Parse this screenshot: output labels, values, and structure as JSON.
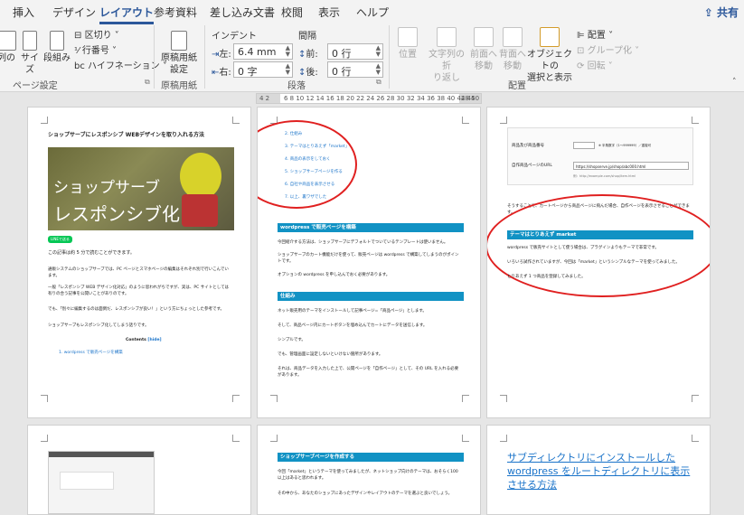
{
  "ribbon": {
    "tabs": [
      "挿入",
      "デザイン",
      "レイアウト",
      "参考資料",
      "差し込み文書",
      "校閲",
      "表示",
      "ヘルプ"
    ],
    "active_tab": "レイアウト",
    "share": "共有",
    "page_setup": {
      "col_label": "列の",
      "size_label": "サイズ",
      "columns_label": "段組み",
      "breaks_label": "区切り",
      "line_numbers_label": "行番号",
      "hyphenation_label": "ハイフネーション",
      "group_label": "ページ設定"
    },
    "manuscript": {
      "button_label": "原稿用紙\n設定",
      "group_label": "原稿用紙"
    },
    "paragraph": {
      "indent_header": "インデント",
      "spacing_header": "間隔",
      "left_label": "左:",
      "left_value": "6.4 mm",
      "right_label": "右:",
      "right_value": "0 字",
      "before_label": "前:",
      "before_value": "0 行",
      "after_label": "後:",
      "after_value": "0 行",
      "group_label": "段落"
    },
    "arrange": {
      "position_label": "位置",
      "wrap_label": "文字列の折\nり返し",
      "forward_label": "前面へ\n移動",
      "backward_label": "背面へ\n移動",
      "selection_label": "オブジェクトの\n選択と表示",
      "align_label": "配置",
      "group_label": "グループ化",
      "rotate_label": "回転",
      "group_name": "配置"
    }
  },
  "ruler": {
    "left_text": "4 2",
    "marks": "6 8 10 12 14 16 18 20 22 24 26 28 30 32 34 36 38 40 42 44",
    "end": "48 50"
  },
  "pages": {
    "p1": {
      "title": "ショップサーブにレスポンシブ WEBデザインを取り入れる方法",
      "image_line1": "ショップサーブ",
      "image_line2": "レスポンシブ化",
      "line_badge": "LINEで送る",
      "lines": [
        "この記事は約 5 分で読むことができます。",
        "通販システムのショップサーブでは、PC ページとスマホページの編集はそれぞれ別で行いこんでいます。",
        "一般「レスポンシブ WEB デザイン化対応」のように思われがちですが、実は、PC サイトとしては有りの合う記事を公開いことがありのです。",
        "でも、「別々に編集するのは面倒だ、レスポンシブが良い！」という方にちょっとした参考です。",
        "ショップサーブもレスポンシブ化してしまう話りです。"
      ],
      "contents_label": "Contents",
      "contents_toggle": "[hide]",
      "toc_item": "1. wordpress で販売ページを構築"
    },
    "p2": {
      "toc": [
        "2. 仕組み",
        "3. テーマはとりあえず「market」",
        "4. 商品の表示をしておく",
        "5. ショップサーブページを作る",
        "6. 自社や商品を表示させる",
        "7. 以上、裏ワザでした"
      ],
      "heading1": "wordpress で販売ページを構築",
      "lines1": [
        "今回紹介する方法は、ショップサーブにデフォルトでついているテンプレートは使いません。",
        "ショップサーブのカート機能だけを使って、販売ページは wordpress で構築してしまうのがポイントです。",
        "オプションの wordpress を申し込んでおく必要があります。"
      ],
      "heading2": "仕組み",
      "lines2": [
        "ネット販売用のテーマをインストールして記事ページ=「商品ページ」とします。",
        "そして、商品ページ内にカートボタンを埋め込んでカートにデータを送信します。",
        "シンプルです。",
        "でも、管理画面に設定しないといけない箇所があります。",
        "それは、商品データを入力した上で、公開ページを「自作ページ」として、その URL を入れる必要があります。"
      ]
    },
    "p3": {
      "form_label1": "商品及び商品番号",
      "form_hint1": "※ 半角数字（1〜999999）／重複可",
      "form_label2": "自作商品ページのURL",
      "form_value2": "https://shopserve.jp/shop/abc000.html",
      "form_example": "例：http://example.com/shop/item.html",
      "line_a": "そうすることで、カートページから商品ページに飛んだ場合、自作ページを表示させることができます。",
      "heading": "テーマはとりあえず market",
      "lines": [
        "wordpress で販売サイトとして使う場合は、プラグインよりもテーマで非常です。",
        "いろいろ試作されていますが、今回は「market」というシンプルなテーマを使ってみました。",
        "とりあえず 1 つ商品を登録してみました。"
      ]
    },
    "p5": {
      "heading": "ショップサーブページを作成する",
      "lines": [
        "今回「market」というテーマを使ってみましたが、ネットショップ向けのテーマは、おそらく100以上はあると思われます。",
        "その中から、あなたのショップにあったデザインやレイアウトのテーマを選ぶと良いでしょう。"
      ]
    },
    "p6": {
      "title": "サブディレクトリにインストールした wordpress をルートディレクトリに表示させる方法"
    }
  },
  "colors": {
    "accent": "#2b579a",
    "heading_bar": "#1192c4",
    "ellipse": "#e02020",
    "link": "#1a73c9"
  }
}
